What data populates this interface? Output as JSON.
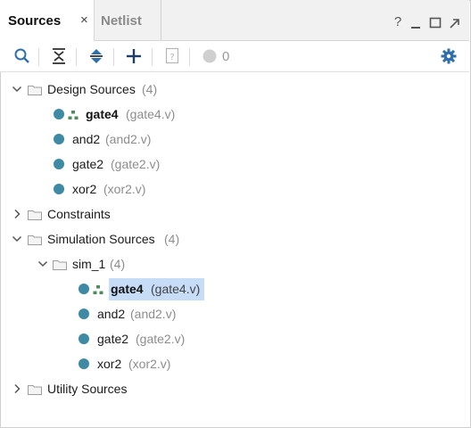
{
  "tabs": [
    {
      "label": "Sources",
      "active": true,
      "close_glyph": "×"
    },
    {
      "label": "Netlist",
      "active": false
    }
  ],
  "window_buttons": [
    {
      "icon": "help-icon",
      "glyph": "?"
    },
    {
      "icon": "minimize-icon",
      "glyph": "_"
    },
    {
      "icon": "maximize-icon",
      "glyph": ""
    },
    {
      "icon": "float-icon",
      "glyph": ""
    }
  ],
  "toolbar": {
    "icons": [
      "search-icon",
      "collapse-all-icon",
      "expand-all-icon",
      "add-sources-icon",
      "unknown-file-icon",
      "status-dot-icon",
      "gear-icon"
    ],
    "count": "0"
  },
  "tree": {
    "design_sources": {
      "label": "Design Sources",
      "count": "(4)"
    },
    "design_items": [
      {
        "name": "gate4",
        "file": "(gate4.v)",
        "top": true
      },
      {
        "name": "and2",
        "file": "(and2.v)",
        "top": false
      },
      {
        "name": "gate2",
        "file": "(gate2.v)",
        "top": false
      },
      {
        "name": "xor2",
        "file": "(xor2.v)",
        "top": false
      }
    ],
    "constraints": {
      "label": "Constraints"
    },
    "simulation_sources": {
      "label": "Simulation Sources",
      "count": "(4)"
    },
    "sim_set": {
      "label": "sim_1",
      "count": "(4)"
    },
    "sim_items": [
      {
        "name": "gate4",
        "file": "(gate4.v)",
        "top": true,
        "selected": true
      },
      {
        "name": "and2",
        "file": "(and2.v)",
        "top": false
      },
      {
        "name": "gate2",
        "file": "(gate2.v)",
        "top": false
      },
      {
        "name": "xor2",
        "file": "(xor2.v)",
        "top": false
      }
    ],
    "utility_sources": {
      "label": "Utility Sources"
    }
  },
  "colors": {
    "accent_dot": "#3e8aa5",
    "selection": "#c6dcf7",
    "gear": "#2f6fae",
    "hierarchy_icon": "#4e8a5a"
  }
}
